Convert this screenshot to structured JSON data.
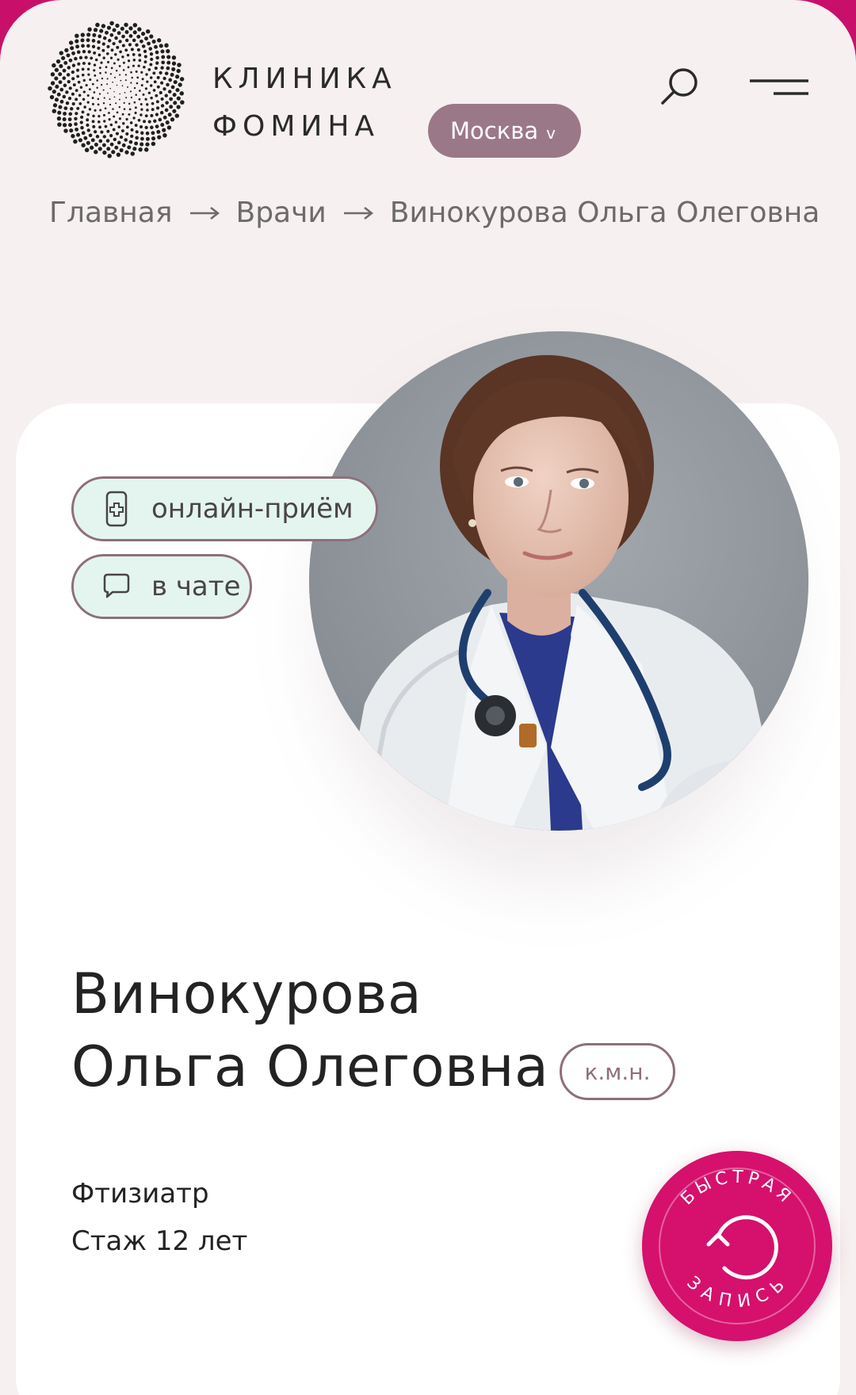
{
  "header": {
    "logo_line1": "КЛИНИКА",
    "logo_line2": "ФОМИНА",
    "city": "Москва",
    "city_chevron": "v",
    "icons": [
      "search-icon",
      "menu-icon"
    ]
  },
  "breadcrumb": {
    "items": [
      "Главная",
      "Врачи",
      "Винокурова Ольга Олеговна"
    ]
  },
  "doctor": {
    "online_label": "онлайн-приём",
    "chat_label": "в чате",
    "name_line1": "Винокурова",
    "name_line2": "Ольга Олеговна",
    "degree": "к.м.н.",
    "specialty": "Фтизиатр",
    "experience": "Стаж 12 лет"
  },
  "quick_booking": {
    "top_text": "БЫСТРАЯ",
    "bottom_text": "ЗАПИСЬ"
  },
  "colors": {
    "accent_pink": "#d6106d",
    "city_button": "#9b7888",
    "pill_bg": "#e3f5ee",
    "page_bg": "#f6f0f0"
  }
}
